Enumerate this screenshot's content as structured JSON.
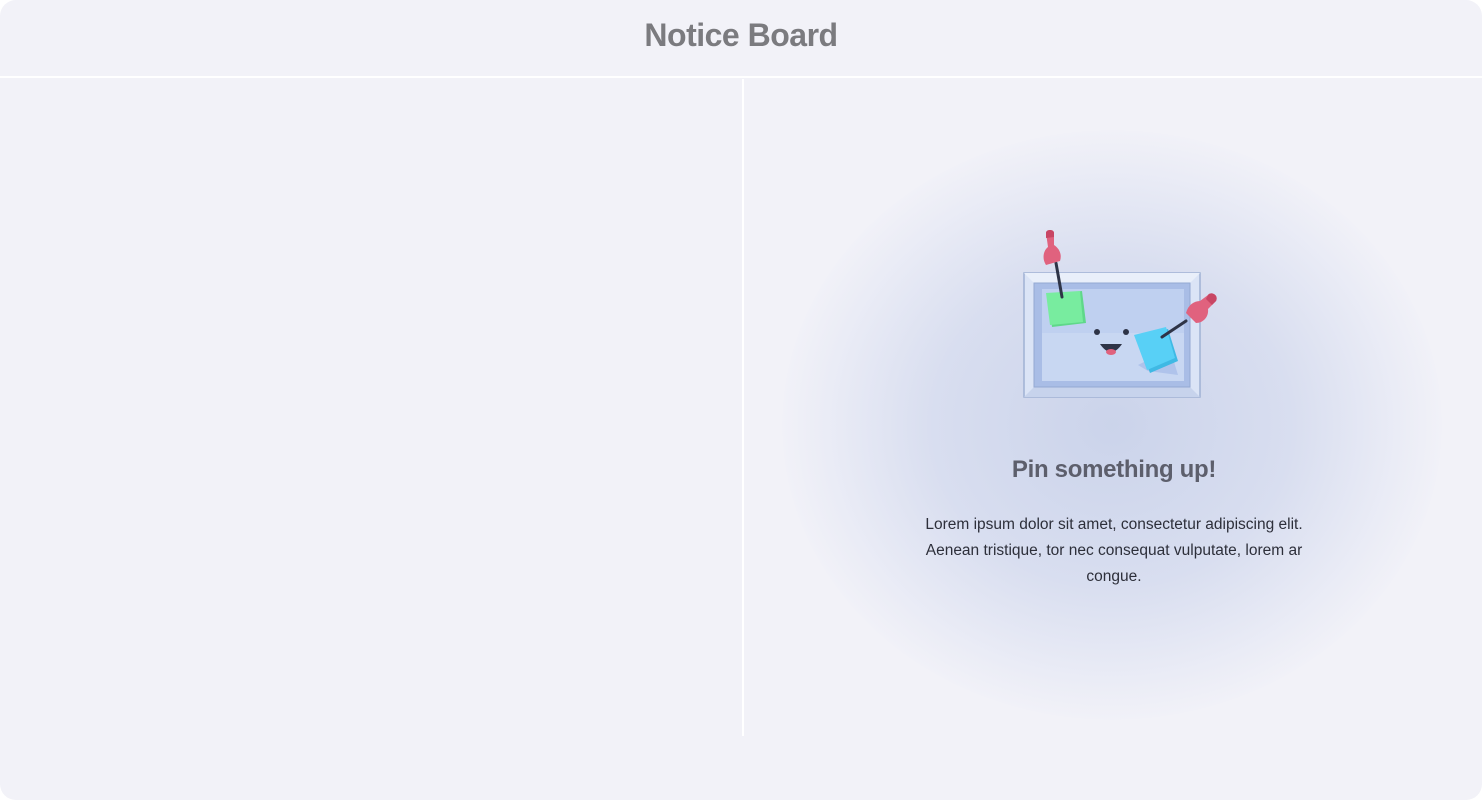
{
  "header": {
    "title": "Notice Board"
  },
  "empty_state": {
    "illustration": "notice-board-illustration",
    "heading": "Pin something up!",
    "body": "Lorem ipsum dolor sit amet, consectetur adipiscing elit. Aenean tristique, tor nec consequat vulputate, lorem ar congue."
  },
  "colors": {
    "background": "#f2f2f8",
    "title": "#7b7b7f",
    "heading": "#5d5f6c",
    "body_text": "#2d2f3a",
    "pin": "#e0627e",
    "green_note": "#6fe79a",
    "blue_note": "#52cbf2",
    "board_frame": "#cdd9f1",
    "board_surface": "#b9cbee"
  }
}
